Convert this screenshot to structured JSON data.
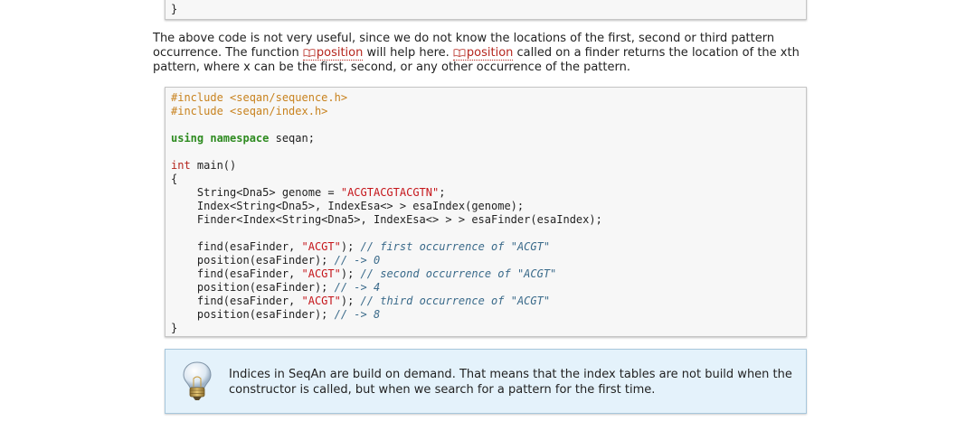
{
  "top_code": {
    "closing_brace": "}"
  },
  "paragraph": {
    "part1": "The above code is not very useful, since we do not know the locations of the first, second or third pattern occurrence. The function ",
    "link1": "position",
    "part2": " will help here. ",
    "link2": "position",
    "part3": " called on a finder returns the location of the xth pattern, where x can be the first, second, or any other occurrence of the pattern."
  },
  "code": {
    "include1_kw": "#include",
    "include1_path": "<seqan/sequence.h>",
    "include2_kw": "#include",
    "include2_path": "<seqan/index.h>",
    "using_kw": "using namespace",
    "using_ns": " seqan;",
    "int_kw": "int",
    "main_sig": " main()",
    "open_brace": "{",
    "genome_decl": "    String<Dna5> genome = ",
    "genome_val": "\"ACGTACGTACGTN\"",
    "genome_end": ";",
    "index_decl": "    Index<String<Dna5>, IndexEsa<> > esaIndex(genome);",
    "finder_decl": "    Finder<Index<String<Dna5>, IndexEsa<> > > esaFinder(esaIndex);",
    "find1": "    find(esaFinder, ",
    "find1_str": "\"ACGT\"",
    "find1_end": "); ",
    "find1_cm": "// first occurrence of \"ACGT\"",
    "pos1": "    position(esaFinder); ",
    "pos1_cm": "// -> 0",
    "find2": "    find(esaFinder, ",
    "find2_str": "\"ACGT\"",
    "find2_end": "); ",
    "find2_cm": "// second occurrence of \"ACGT\"",
    "pos2": "    position(esaFinder); ",
    "pos2_cm": "// -> 4",
    "find3": "    find(esaFinder, ",
    "find3_str": "\"ACGT\"",
    "find3_end": "); ",
    "find3_cm": "// third occurrence of \"ACGT\"",
    "pos3": "    position(esaFinder); ",
    "pos3_cm": "// -> 8",
    "close_brace": "}"
  },
  "note": {
    "icon": "lightbulb-icon",
    "text": "Indices in SeqAn are build on demand. That means that the index tables are not build when the constructor is called, but when we search for a pattern for the first time."
  },
  "colors": {
    "preprocessor": "#c8821e",
    "keyword": "#2e8b20",
    "string": "#c5161b",
    "comment": "#3a6a8a",
    "note_bg": "#e4f2fb"
  }
}
